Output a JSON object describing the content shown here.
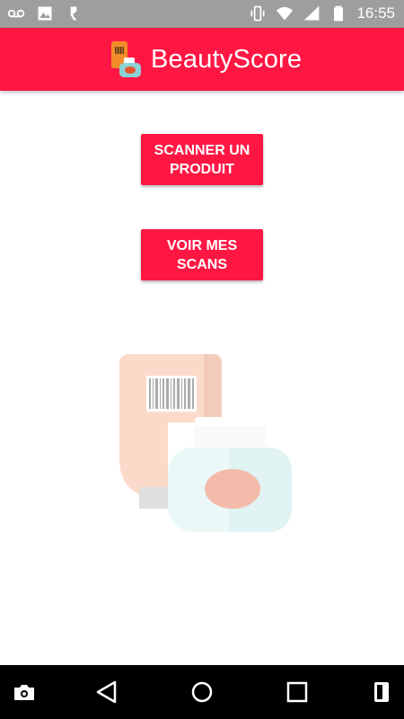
{
  "status_bar": {
    "time": "16:55",
    "left_icons": [
      "voicemail-icon",
      "image-icon",
      "accessibility-icon"
    ],
    "right_icons": [
      "vibrate-icon",
      "wifi-icon",
      "signal-icon",
      "battery-icon"
    ]
  },
  "app_bar": {
    "title": "BeautyScore",
    "logo_icon": "beauty-products-logo-icon"
  },
  "actions": {
    "scan_label": "SCANNER UN PRODUIT",
    "my_scans_label": "VOIR MES SCANS"
  },
  "colors": {
    "accent": "#ff1744",
    "status_bar": "#9e9e9e",
    "nav_bar": "#000000"
  },
  "nav_bar": {
    "icons": [
      "camera-switch-icon",
      "back-icon",
      "home-icon",
      "recents-icon",
      "split-screen-icon"
    ]
  }
}
